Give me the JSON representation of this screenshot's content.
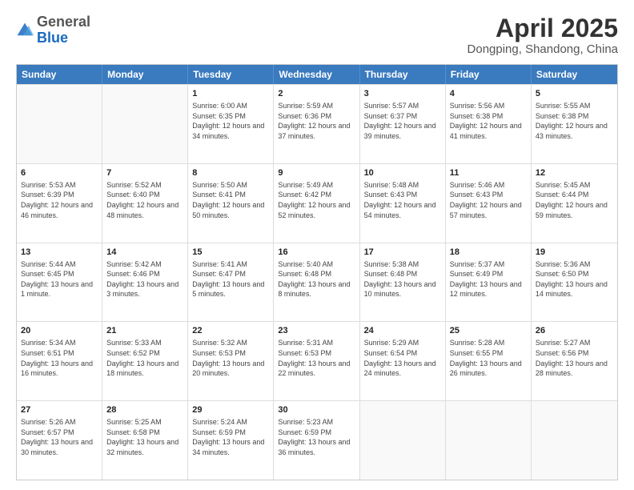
{
  "logo": {
    "general": "General",
    "blue": "Blue"
  },
  "title": {
    "month": "April 2025",
    "location": "Dongping, Shandong, China"
  },
  "calendar": {
    "headers": [
      "Sunday",
      "Monday",
      "Tuesday",
      "Wednesday",
      "Thursday",
      "Friday",
      "Saturday"
    ],
    "rows": [
      [
        {
          "day": "",
          "info": ""
        },
        {
          "day": "",
          "info": ""
        },
        {
          "day": "1",
          "info": "Sunrise: 6:00 AM\nSunset: 6:35 PM\nDaylight: 12 hours and 34 minutes."
        },
        {
          "day": "2",
          "info": "Sunrise: 5:59 AM\nSunset: 6:36 PM\nDaylight: 12 hours and 37 minutes."
        },
        {
          "day": "3",
          "info": "Sunrise: 5:57 AM\nSunset: 6:37 PM\nDaylight: 12 hours and 39 minutes."
        },
        {
          "day": "4",
          "info": "Sunrise: 5:56 AM\nSunset: 6:38 PM\nDaylight: 12 hours and 41 minutes."
        },
        {
          "day": "5",
          "info": "Sunrise: 5:55 AM\nSunset: 6:38 PM\nDaylight: 12 hours and 43 minutes."
        }
      ],
      [
        {
          "day": "6",
          "info": "Sunrise: 5:53 AM\nSunset: 6:39 PM\nDaylight: 12 hours and 46 minutes."
        },
        {
          "day": "7",
          "info": "Sunrise: 5:52 AM\nSunset: 6:40 PM\nDaylight: 12 hours and 48 minutes."
        },
        {
          "day": "8",
          "info": "Sunrise: 5:50 AM\nSunset: 6:41 PM\nDaylight: 12 hours and 50 minutes."
        },
        {
          "day": "9",
          "info": "Sunrise: 5:49 AM\nSunset: 6:42 PM\nDaylight: 12 hours and 52 minutes."
        },
        {
          "day": "10",
          "info": "Sunrise: 5:48 AM\nSunset: 6:43 PM\nDaylight: 12 hours and 54 minutes."
        },
        {
          "day": "11",
          "info": "Sunrise: 5:46 AM\nSunset: 6:43 PM\nDaylight: 12 hours and 57 minutes."
        },
        {
          "day": "12",
          "info": "Sunrise: 5:45 AM\nSunset: 6:44 PM\nDaylight: 12 hours and 59 minutes."
        }
      ],
      [
        {
          "day": "13",
          "info": "Sunrise: 5:44 AM\nSunset: 6:45 PM\nDaylight: 13 hours and 1 minute."
        },
        {
          "day": "14",
          "info": "Sunrise: 5:42 AM\nSunset: 6:46 PM\nDaylight: 13 hours and 3 minutes."
        },
        {
          "day": "15",
          "info": "Sunrise: 5:41 AM\nSunset: 6:47 PM\nDaylight: 13 hours and 5 minutes."
        },
        {
          "day": "16",
          "info": "Sunrise: 5:40 AM\nSunset: 6:48 PM\nDaylight: 13 hours and 8 minutes."
        },
        {
          "day": "17",
          "info": "Sunrise: 5:38 AM\nSunset: 6:48 PM\nDaylight: 13 hours and 10 minutes."
        },
        {
          "day": "18",
          "info": "Sunrise: 5:37 AM\nSunset: 6:49 PM\nDaylight: 13 hours and 12 minutes."
        },
        {
          "day": "19",
          "info": "Sunrise: 5:36 AM\nSunset: 6:50 PM\nDaylight: 13 hours and 14 minutes."
        }
      ],
      [
        {
          "day": "20",
          "info": "Sunrise: 5:34 AM\nSunset: 6:51 PM\nDaylight: 13 hours and 16 minutes."
        },
        {
          "day": "21",
          "info": "Sunrise: 5:33 AM\nSunset: 6:52 PM\nDaylight: 13 hours and 18 minutes."
        },
        {
          "day": "22",
          "info": "Sunrise: 5:32 AM\nSunset: 6:53 PM\nDaylight: 13 hours and 20 minutes."
        },
        {
          "day": "23",
          "info": "Sunrise: 5:31 AM\nSunset: 6:53 PM\nDaylight: 13 hours and 22 minutes."
        },
        {
          "day": "24",
          "info": "Sunrise: 5:29 AM\nSunset: 6:54 PM\nDaylight: 13 hours and 24 minutes."
        },
        {
          "day": "25",
          "info": "Sunrise: 5:28 AM\nSunset: 6:55 PM\nDaylight: 13 hours and 26 minutes."
        },
        {
          "day": "26",
          "info": "Sunrise: 5:27 AM\nSunset: 6:56 PM\nDaylight: 13 hours and 28 minutes."
        }
      ],
      [
        {
          "day": "27",
          "info": "Sunrise: 5:26 AM\nSunset: 6:57 PM\nDaylight: 13 hours and 30 minutes."
        },
        {
          "day": "28",
          "info": "Sunrise: 5:25 AM\nSunset: 6:58 PM\nDaylight: 13 hours and 32 minutes."
        },
        {
          "day": "29",
          "info": "Sunrise: 5:24 AM\nSunset: 6:59 PM\nDaylight: 13 hours and 34 minutes."
        },
        {
          "day": "30",
          "info": "Sunrise: 5:23 AM\nSunset: 6:59 PM\nDaylight: 13 hours and 36 minutes."
        },
        {
          "day": "",
          "info": ""
        },
        {
          "day": "",
          "info": ""
        },
        {
          "day": "",
          "info": ""
        }
      ]
    ]
  }
}
